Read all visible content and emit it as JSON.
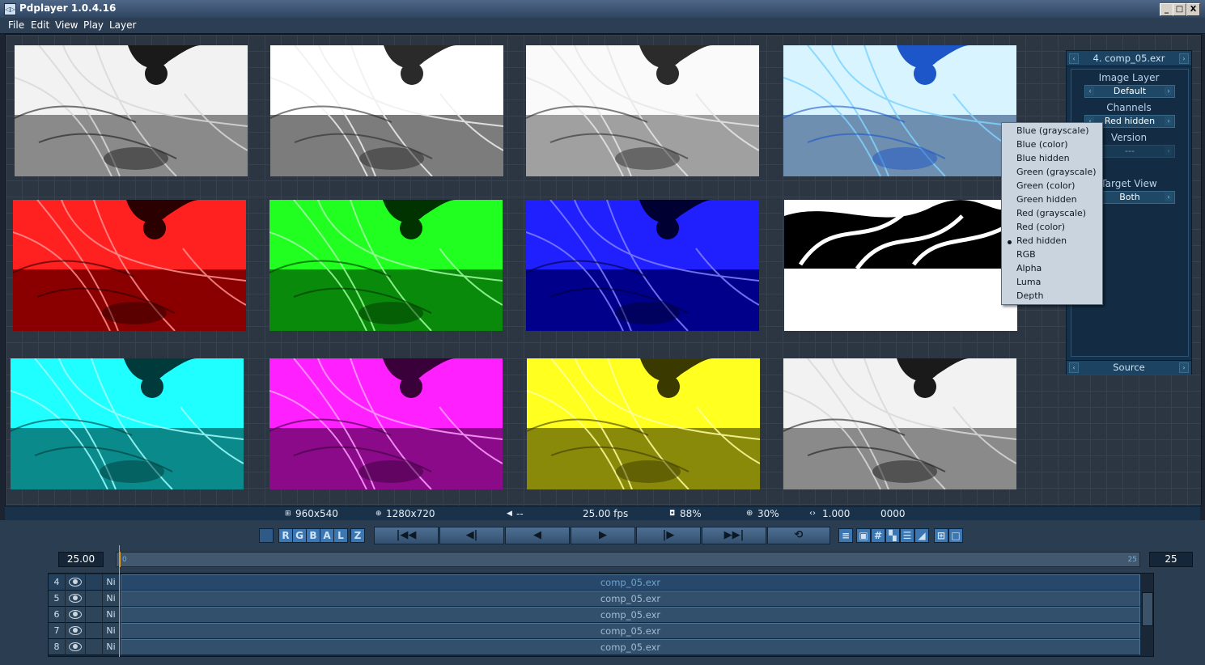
{
  "window": {
    "title": "Pdplayer 1.0.4.16",
    "app_icon": "player-icon",
    "min_label": "_",
    "max_label": "□",
    "close_label": "X"
  },
  "menu": [
    "File",
    "Edit",
    "View",
    "Play",
    "Layer"
  ],
  "thumbnails": [
    {
      "tint": "gray"
    },
    {
      "tint": "gray-inverted"
    },
    {
      "tint": "gray-light"
    },
    {
      "tint": "color"
    },
    {
      "tint": "red"
    },
    {
      "tint": "green"
    },
    {
      "tint": "blue"
    },
    {
      "tint": "alpha"
    },
    {
      "tint": "cyan"
    },
    {
      "tint": "magenta"
    },
    {
      "tint": "yellow"
    },
    {
      "tint": "gray"
    }
  ],
  "panel": {
    "layer_title": "4. comp_05.exr",
    "image_layer_label": "Image Layer",
    "image_layer_value": "Default",
    "channels_label": "Channels",
    "channels_value": "Red hidden",
    "version_label": "Version",
    "version_value": "---",
    "target_view_label": "Target View",
    "target_view_value": "Both",
    "footer_label": "Source"
  },
  "channels_menu": {
    "items": [
      "Blue (grayscale)",
      "Blue (color)",
      "Blue hidden",
      "Green (grayscale)",
      "Green (color)",
      "Green hidden",
      "Red (grayscale)",
      "Red (color)",
      "Red hidden",
      "RGB",
      "Alpha",
      "Luma",
      "Depth"
    ],
    "selected": "Red hidden"
  },
  "infobar": {
    "resolution": "960x540",
    "canvas": "1280x720",
    "audio": "--",
    "fps": "25.00 fps",
    "cache": "88%",
    "zoom": "30%",
    "speed": "1.000",
    "frame": "0000"
  },
  "channel_buttons": [
    "R",
    "G",
    "B",
    "A",
    "L",
    "Z"
  ],
  "transport": {
    "first_icon": "skip-to-start-icon",
    "prev_frame_icon": "step-back-icon",
    "play_reverse_icon": "play-reverse-icon",
    "play_icon": "play-icon",
    "next_frame_icon": "step-forward-icon",
    "last_icon": "skip-to-end-icon",
    "loop_icon": "loop-icon"
  },
  "timeline": {
    "fps_value": "25.00",
    "start_label": "0",
    "end_label": "25",
    "end_frame": "25"
  },
  "layers": [
    {
      "num": "4",
      "name": "comp_05.exr",
      "blend": "Ni",
      "selected": true
    },
    {
      "num": "5",
      "name": "comp_05.exr",
      "blend": "Ni",
      "selected": false
    },
    {
      "num": "6",
      "name": "comp_05.exr",
      "blend": "Ni",
      "selected": false
    },
    {
      "num": "7",
      "name": "comp_05.exr",
      "blend": "Ni",
      "selected": false
    },
    {
      "num": "8",
      "name": "comp_05.exr",
      "blend": "Ni",
      "selected": false
    }
  ],
  "colors": {
    "accent": "#3d77b1",
    "background": "#2c3542",
    "panel": "#15314a",
    "playhead": "#e0a030"
  }
}
